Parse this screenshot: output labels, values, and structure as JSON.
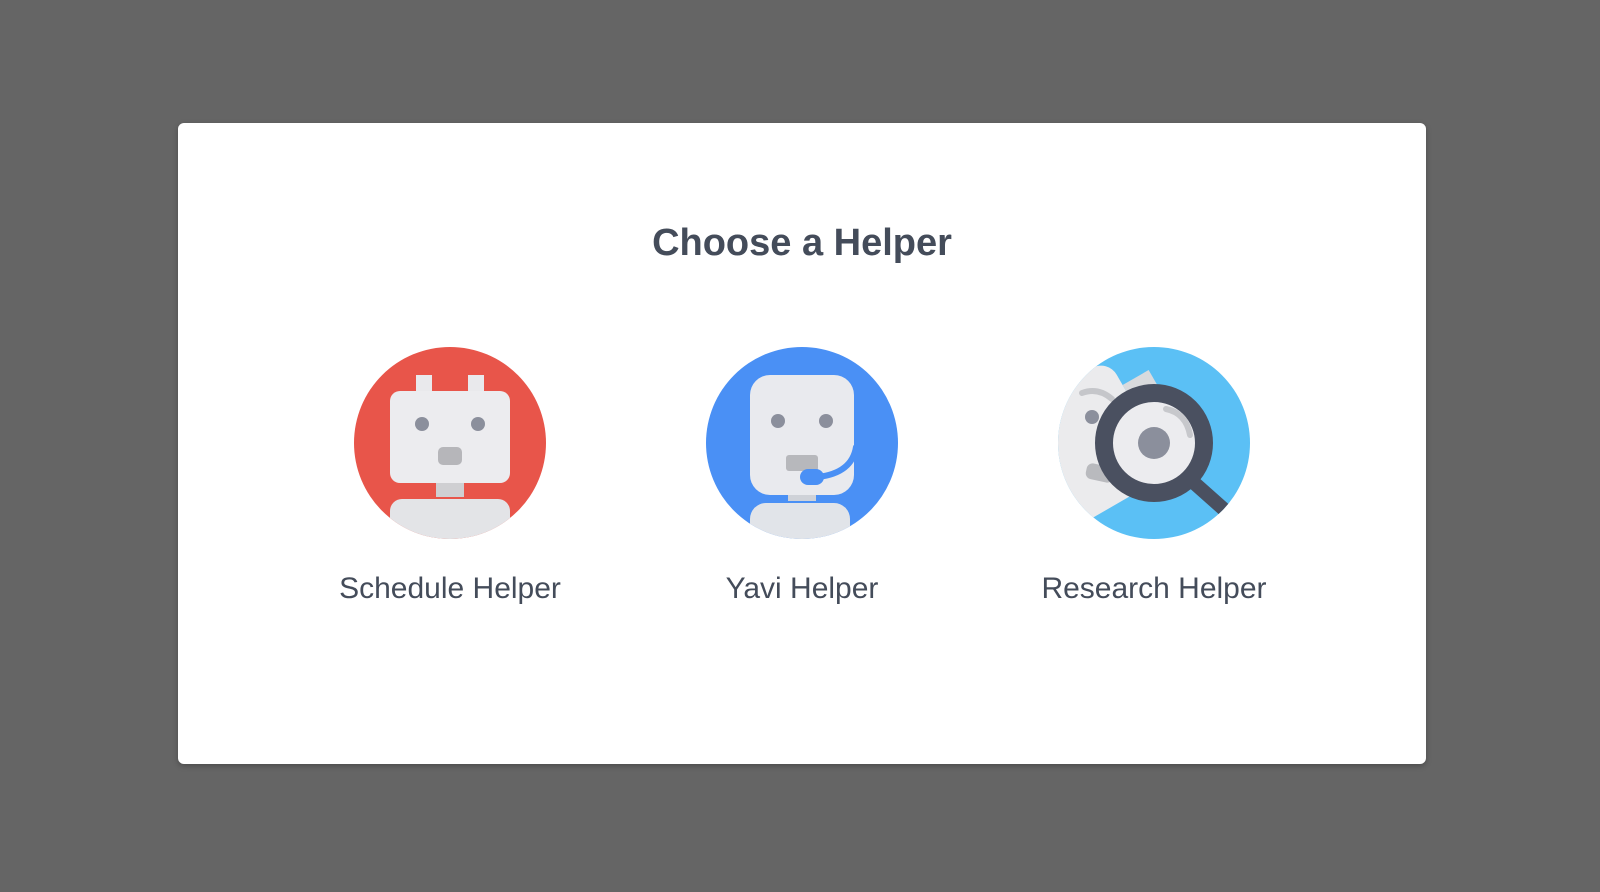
{
  "dialog": {
    "title": "Choose a Helper"
  },
  "helpers": [
    {
      "label": "Schedule Helper",
      "icon": "schedule-robot-icon",
      "color": "#e8554a"
    },
    {
      "label": "Yavi Helper",
      "icon": "headset-robot-icon",
      "color": "#4a90f5"
    },
    {
      "label": "Research Helper",
      "icon": "magnifier-robot-icon",
      "color": "#5bc0f5"
    }
  ]
}
